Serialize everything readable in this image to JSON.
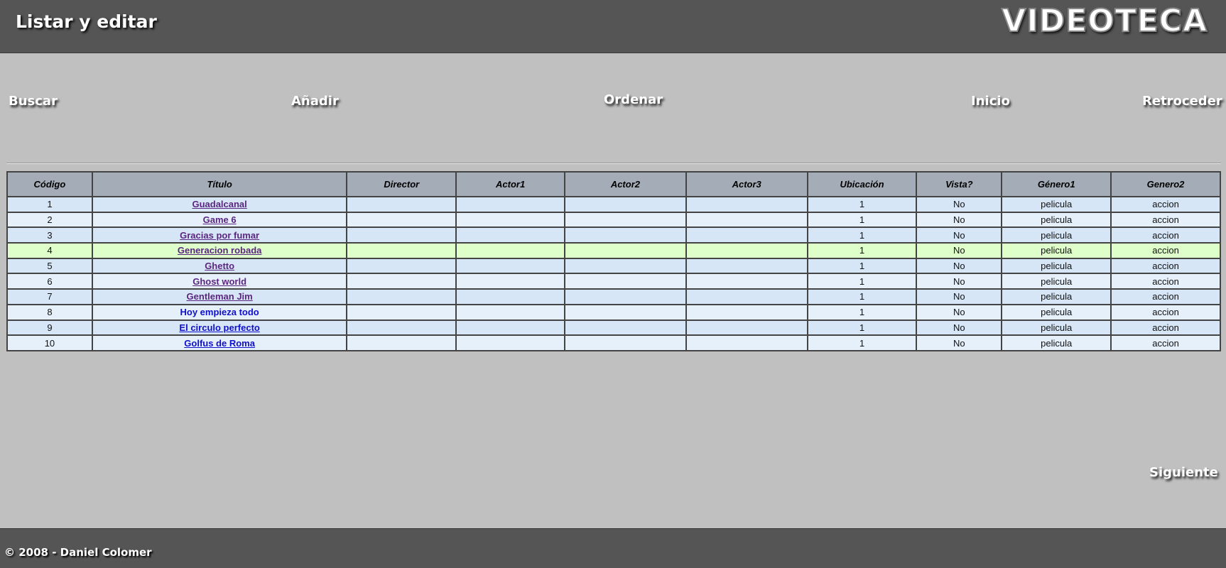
{
  "header": {
    "title": "Listar y editar",
    "logo": "VIDEOTECA"
  },
  "nav": {
    "buscar": "Buscar",
    "anadir": "Añadir",
    "ordenar": "Ordenar",
    "inicio": "Inicio",
    "retroceder": "Retroceder",
    "siguiente": "Siguiente"
  },
  "table": {
    "columns": [
      "Código",
      "Título",
      "Director",
      "Actor1",
      "Actor2",
      "Actor3",
      "Ubicación",
      "Vista?",
      "Género1",
      "Genero2"
    ],
    "rows": [
      {
        "codigo": "1",
        "titulo": "Guadalcanal",
        "director": "",
        "actor1": "",
        "actor2": "",
        "actor3": "",
        "ubicacion": "1",
        "vista": "No",
        "genero1": "pelicula",
        "genero2": "accion"
      },
      {
        "codigo": "2",
        "titulo": "Game 6",
        "director": "",
        "actor1": "",
        "actor2": "",
        "actor3": "",
        "ubicacion": "1",
        "vista": "No",
        "genero1": "pelicula",
        "genero2": "accion"
      },
      {
        "codigo": "3",
        "titulo": "Gracias por fumar",
        "director": "",
        "actor1": "",
        "actor2": "",
        "actor3": "",
        "ubicacion": "1",
        "vista": "No",
        "genero1": "pelicula",
        "genero2": "accion"
      },
      {
        "codigo": "4",
        "titulo": "Generacion robada",
        "director": "",
        "actor1": "",
        "actor2": "",
        "actor3": "",
        "ubicacion": "1",
        "vista": "No",
        "genero1": "pelicula",
        "genero2": "accion"
      },
      {
        "codigo": "5",
        "titulo": "Ghetto",
        "director": "",
        "actor1": "",
        "actor2": "",
        "actor3": "",
        "ubicacion": "1",
        "vista": "No",
        "genero1": "pelicula",
        "genero2": "accion"
      },
      {
        "codigo": "6",
        "titulo": "Ghost world",
        "director": "",
        "actor1": "",
        "actor2": "",
        "actor3": "",
        "ubicacion": "1",
        "vista": "No",
        "genero1": "pelicula",
        "genero2": "accion"
      },
      {
        "codigo": "7",
        "titulo": "Gentleman Jim",
        "director": "",
        "actor1": "",
        "actor2": "",
        "actor3": "",
        "ubicacion": "1",
        "vista": "No",
        "genero1": "pelicula",
        "genero2": "accion"
      },
      {
        "codigo": "8",
        "titulo": "Hoy empieza todo",
        "director": "",
        "actor1": "",
        "actor2": "",
        "actor3": "",
        "ubicacion": "1",
        "vista": "No",
        "genero1": "pelicula",
        "genero2": "accion"
      },
      {
        "codigo": "9",
        "titulo": "El circulo perfecto",
        "director": "",
        "actor1": "",
        "actor2": "",
        "actor3": "",
        "ubicacion": "1",
        "vista": "No",
        "genero1": "pelicula",
        "genero2": "accion"
      },
      {
        "codigo": "10",
        "titulo": "Golfus de Roma",
        "director": "",
        "actor1": "",
        "actor2": "",
        "actor3": "",
        "ubicacion": "1",
        "vista": "No",
        "genero1": "pelicula",
        "genero2": "accion"
      }
    ]
  },
  "footer": {
    "copyright": "© 2008 - Daniel Colomer"
  }
}
